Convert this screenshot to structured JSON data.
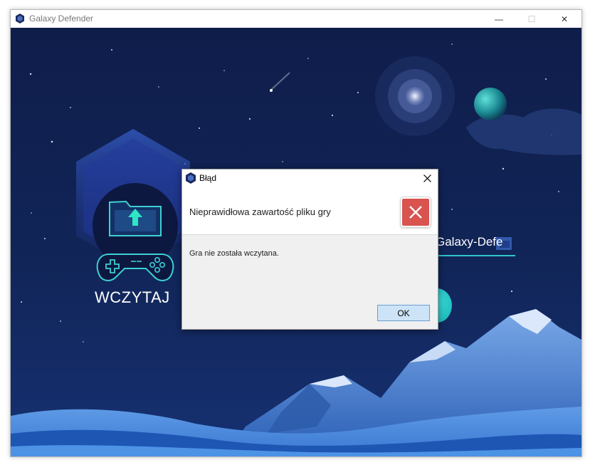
{
  "window": {
    "title": "Galaxy Defender",
    "minimize_glyph": "—",
    "maximize_glyph": "☐",
    "close_glyph": "✕"
  },
  "background": {
    "load_label": "WCZYTAJ",
    "game_label": "Galaxy-Defe",
    "colors": {
      "sky": "#0f1c48",
      "accent": "#2ec6c8"
    }
  },
  "dialog": {
    "title": "Błąd",
    "heading": "Nieprawidłowa zawartość pliku gry",
    "message": "Gra nie została wczytana.",
    "ok_label": "OK",
    "icon": "error-icon",
    "colors": {
      "error": "#d9534f",
      "button": "#cde3f7"
    }
  }
}
